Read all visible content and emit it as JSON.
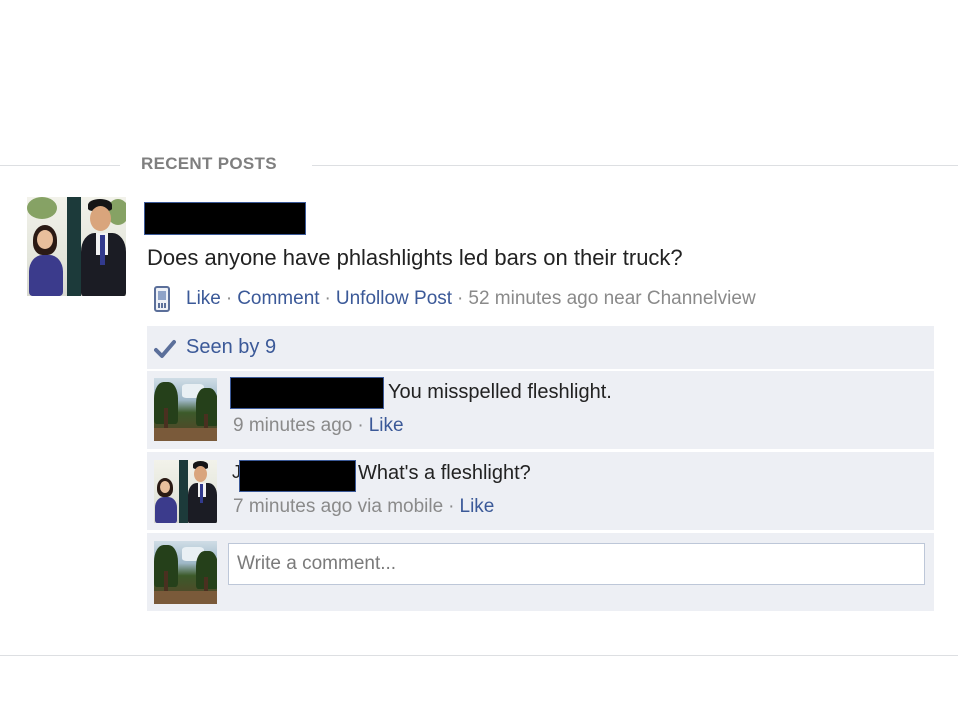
{
  "section": {
    "title": "RECENT POSTS"
  },
  "post": {
    "text": "Does anyone have phlashlights led bars on their truck?",
    "actions": {
      "like": "Like",
      "comment": "Comment",
      "unfollow": "Unfollow Post",
      "sep": "·"
    },
    "timestamp": "52 minutes ago near Channelview",
    "icons": {
      "source": "mobile-phone-icon"
    }
  },
  "seen": {
    "label": "Seen by 9",
    "icon": "checkmark-icon"
  },
  "comments": [
    {
      "text": "You misspelled fleshlight.",
      "time": "9 minutes ago",
      "like": "Like"
    },
    {
      "prefix": "J",
      "text": "What's a fleshlight?",
      "time": "7 minutes ago via mobile",
      "like": "Like"
    }
  ],
  "composer": {
    "placeholder": "Write a comment..."
  },
  "colors": {
    "link": "#3b5998",
    "panel": "#edeff4",
    "meta": "#8a8a8a",
    "divider": "#dddfe2"
  }
}
